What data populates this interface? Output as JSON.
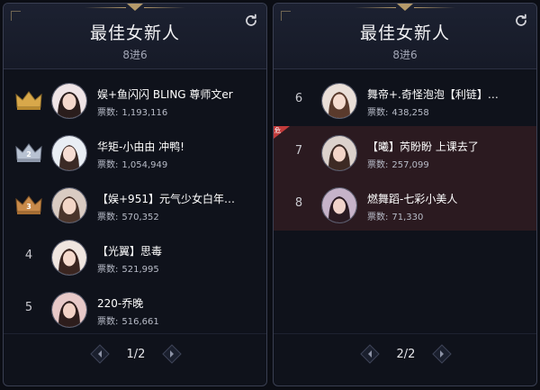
{
  "colors": {
    "gold": "#d8a84a",
    "silver": "#b8c2d2",
    "bronze": "#c98a4a",
    "highlight": "#2b1a20",
    "badge": "#c23b3b"
  },
  "icons": {
    "refresh": "refresh-icon",
    "prev": "chevron-left-icon",
    "next": "chevron-right-icon",
    "crown": "crown-icon"
  },
  "left": {
    "title": "最佳女新人",
    "subtitle": "8进6",
    "pager": "1/2",
    "items": [
      {
        "rank": "1",
        "crown": "gold",
        "crown_num": "",
        "name": "娱+鱼闪闪 BLING 尊师文er",
        "votes_label": "票数:",
        "votes": "1,193,116"
      },
      {
        "rank": "2",
        "crown": "silver",
        "crown_num": "2",
        "name": "华矩-小由由 冲鸭!",
        "votes_label": "票数:",
        "votes": "1,054,949"
      },
      {
        "rank": "3",
        "crown": "bronze",
        "crown_num": "3",
        "name": "【娱+951】元气少女白年…",
        "votes_label": "票数:",
        "votes": "570,352"
      },
      {
        "rank": "4",
        "crown": "",
        "crown_num": "",
        "name": "【光翼】思毒",
        "votes_label": "票数:",
        "votes": "521,995"
      },
      {
        "rank": "5",
        "crown": "",
        "crown_num": "",
        "name": "220-乔晚",
        "votes_label": "票数:",
        "votes": "516,661"
      }
    ]
  },
  "right": {
    "title": "最佳女新人",
    "subtitle": "8进6",
    "pager": "2/2",
    "items": [
      {
        "rank": "6",
        "name": "舞帝+.奇怪泡泡【利链】…",
        "votes_label": "票数:",
        "votes": "438,258",
        "highlight": false,
        "badge": ""
      },
      {
        "rank": "7",
        "name": "【曦】芮盼盼 上课去了",
        "votes_label": "票数:",
        "votes": "257,099",
        "highlight": true,
        "badge": "危"
      },
      {
        "rank": "8",
        "name": "燃舞蹈-七彩小美人",
        "votes_label": "票数:",
        "votes": "71,330",
        "highlight": true,
        "badge": ""
      }
    ]
  }
}
